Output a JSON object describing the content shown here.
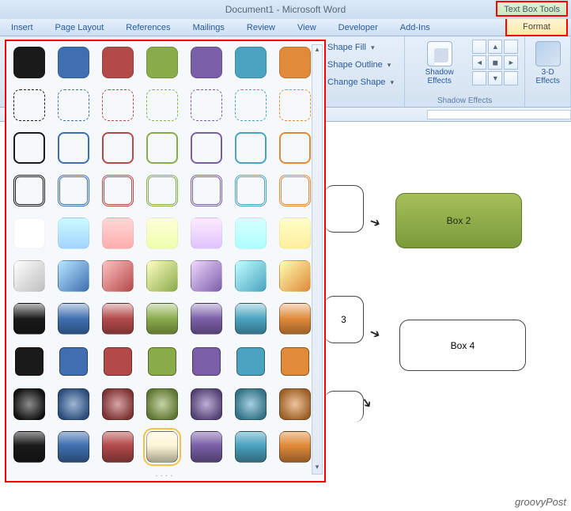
{
  "title": "Document1 - Microsoft Word",
  "context_tab": "Text Box Tools",
  "tabs": [
    "Insert",
    "Page Layout",
    "References",
    "Mailings",
    "Review",
    "View",
    "Developer",
    "Add-Ins"
  ],
  "format_tab": "Format",
  "ribbon": {
    "shape_fill": "Shape Fill",
    "shape_outline": "Shape Outline",
    "change_shape": "Change Shape",
    "shadow_effects": "Shadow\nEffects",
    "shadow_group_label": "Shadow Effects",
    "threed": "3-D\nEffects"
  },
  "colors": {
    "black": "#1a1a1a",
    "blue": "#3f6fb0",
    "red": "#b34a4a",
    "green": "#8aab4a",
    "purple": "#7a5fa8",
    "teal": "#4aa3c0",
    "orange": "#e08a3a",
    "gray": "#bfbfbf"
  },
  "gallery_rows": [
    {
      "type": "solid",
      "palette": [
        "black",
        "blue",
        "red",
        "green",
        "purple",
        "teal",
        "orange"
      ]
    },
    {
      "type": "dashed",
      "palette": [
        "black",
        "blue",
        "red",
        "green",
        "purple",
        "teal",
        "orange"
      ]
    },
    {
      "type": "thin",
      "palette": [
        "black",
        "blue",
        "red",
        "green",
        "purple",
        "teal",
        "orange"
      ]
    },
    {
      "type": "double",
      "palette": [
        "black",
        "blue",
        "red",
        "green",
        "purple",
        "teal",
        "orange"
      ]
    },
    {
      "type": "grad1",
      "palette": [
        "gray",
        "blue",
        "red",
        "green",
        "purple",
        "teal",
        "orange"
      ]
    },
    {
      "type": "grad2",
      "palette": [
        "gray",
        "blue",
        "red",
        "green",
        "purple",
        "teal",
        "orange"
      ]
    },
    {
      "type": "glossy",
      "palette": [
        "black",
        "blue",
        "red",
        "green",
        "purple",
        "teal",
        "orange"
      ]
    },
    {
      "type": "solid2",
      "palette": [
        "black",
        "blue",
        "red",
        "green",
        "purple",
        "teal",
        "orange"
      ]
    },
    {
      "type": "pillow",
      "palette": [
        "black",
        "blue",
        "red",
        "green",
        "purple",
        "teal",
        "orange"
      ]
    },
    {
      "type": "gloss2",
      "palette": [
        "black",
        "blue",
        "red",
        "green",
        "purple",
        "teal",
        "orange"
      ],
      "selected": 3
    }
  ],
  "doc": {
    "box2": "Box 2",
    "box3_fragment": "3",
    "box4": "Box 4"
  },
  "watermark": "groovyPost"
}
